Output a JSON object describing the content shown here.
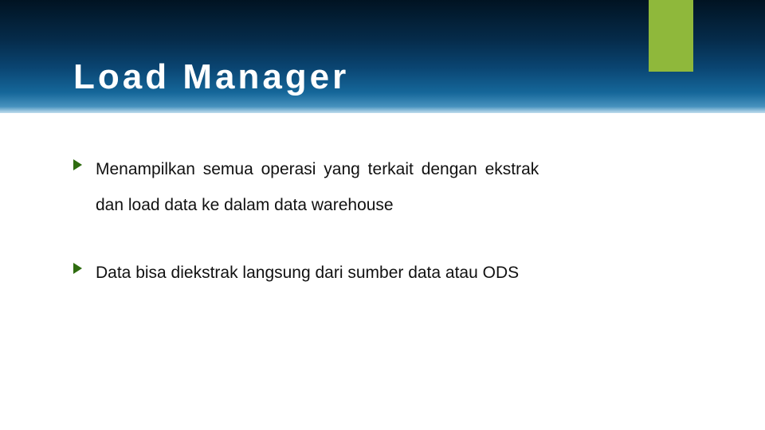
{
  "title": "Load Manager",
  "bullets": [
    {
      "line1": "Menampilkan semua operasi yang terkait dengan ekstrak",
      "line2": "dan load data ke dalam data warehouse"
    },
    {
      "line1": "Data bisa diekstrak langsung dari sumber data atau ODS",
      "line2": ""
    }
  ],
  "colors": {
    "accent": "#8fb83b",
    "bullet_arrow": "#2e6c0f"
  }
}
